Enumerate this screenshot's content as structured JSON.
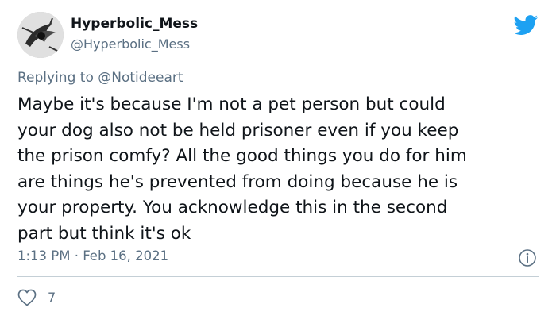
{
  "tweet": {
    "author": {
      "display_name": "Hyperbolic_Mess",
      "handle": "@Hyperbolic_Mess",
      "avatar_icon": "avatar-image"
    },
    "brand_icon": "twitter-bird-icon",
    "reply_context": {
      "prefix": "Replying to",
      "mention": "@Notideeart"
    },
    "body_lines": [
      "Maybe it's because I'm not a pet person but could",
      "your dog also not be held prisoner even if you keep",
      "the prison comfy? All the good things you do for him",
      "are things he's prevented from doing because he is",
      "your property. You acknowledge this in the second",
      "part but think it's ok"
    ],
    "timestamp": "1:13 PM · Feb 16, 2021",
    "info_icon": "info-icon",
    "like_icon": "heart-icon",
    "like_count": "7"
  },
  "colors": {
    "text": "#0f1419",
    "secondary": "#5b7083",
    "brand": "#1da1f2",
    "divider": "#c4cfd6"
  }
}
